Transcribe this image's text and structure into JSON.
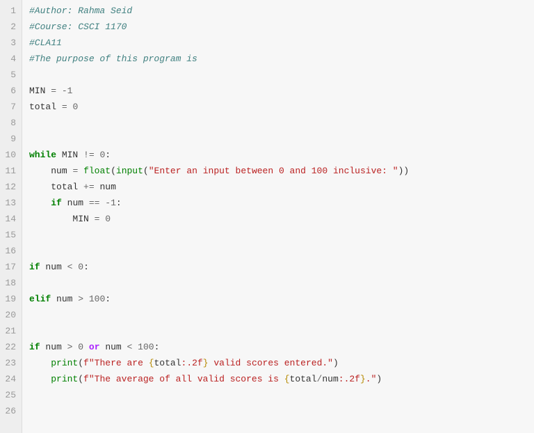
{
  "lines": {
    "1": {
      "num": "1",
      "comment": "#Author: Rahma Seid"
    },
    "2": {
      "num": "2",
      "comment": "#Course: CSCI 1170"
    },
    "3": {
      "num": "3",
      "comment": "#CLA11"
    },
    "4": {
      "num": "4",
      "comment": "#The purpose of this program is"
    },
    "5": {
      "num": "5"
    },
    "6": {
      "num": "6",
      "name1": "MIN",
      "op": "=",
      "val": "-1"
    },
    "7": {
      "num": "7",
      "name1": "total",
      "op": "=",
      "val": "0"
    },
    "8": {
      "num": "8"
    },
    "9": {
      "num": "9"
    },
    "10": {
      "num": "10",
      "kw": "while",
      "name1": "MIN",
      "op": "!=",
      "val": "0",
      "colon": ":"
    },
    "11": {
      "num": "11",
      "indent": "    ",
      "name1": "num",
      "op": "=",
      "builtin1": "float",
      "p1": "(",
      "builtin2": "input",
      "p2": "(",
      "str": "\"Enter an input between 0 and 100 inclusive: \"",
      "p3": "))"
    },
    "12": {
      "num": "12",
      "indent": "    ",
      "name1": "total",
      "op": "+=",
      "name2": "num"
    },
    "13": {
      "num": "13",
      "indent": "    ",
      "kw": "if",
      "name1": "num",
      "op": "==",
      "val": "-1",
      "colon": ":"
    },
    "14": {
      "num": "14",
      "indent": "        ",
      "name1": "MIN",
      "op": "=",
      "val": "0"
    },
    "15": {
      "num": "15"
    },
    "16": {
      "num": "16"
    },
    "17": {
      "num": "17",
      "kw": "if",
      "name1": "num",
      "op": "<",
      "val": "0",
      "colon": ":"
    },
    "18": {
      "num": "18"
    },
    "19": {
      "num": "19",
      "kw": "elif",
      "name1": "num",
      "op": ">",
      "val": "100",
      "colon": ":"
    },
    "20": {
      "num": "20"
    },
    "21": {
      "num": "21"
    },
    "22": {
      "num": "22",
      "kw": "if",
      "name1": "num",
      "op": ">",
      "val": "0",
      "kw2": "or",
      "name2": "num",
      "op2": "<",
      "val2": "100",
      "colon": ":"
    },
    "23": {
      "num": "23",
      "indent": "    ",
      "builtin1": "print",
      "p1": "(",
      "affix": "f",
      "s1": "\"There are ",
      "ib1": "{",
      "iname": "total",
      "ifmt": ":.2f",
      "ib2": "}",
      "s2": " valid scores entered.\"",
      "p2": ")"
    },
    "24": {
      "num": "24",
      "indent": "    ",
      "builtin1": "print",
      "p1": "(",
      "affix": "f",
      "s1": "\"The average of all valid scores is ",
      "ib1": "{",
      "iname": "total",
      "islash": "/",
      "iname2": "num",
      "ifmt": ":.2f",
      "ib2": "}",
      "s2": ".\"",
      "p2": ")"
    },
    "25": {
      "num": "25"
    },
    "26": {
      "num": "26"
    }
  }
}
